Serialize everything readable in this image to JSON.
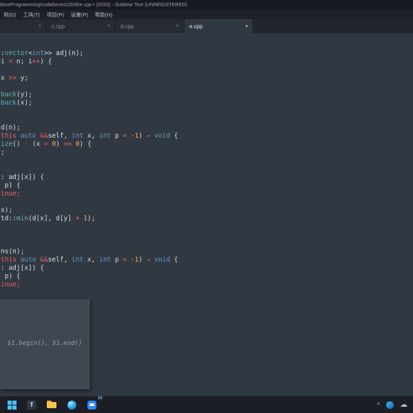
{
  "title_bar": {
    "title": "titiveProgramming\\codeforces\\2028\\e.cpp • (2033) - Sublime Text (UNREGISTERED)"
  },
  "menu_bar": {
    "items": [
      "到(G)",
      "工具(T)",
      "项目(P)",
      "设置(P)",
      "帮助(H)"
    ]
  },
  "tabs": [
    {
      "label": "",
      "close": "×",
      "active": false,
      "partial": true,
      "modified": false
    },
    {
      "label": "c.cpp",
      "close": "×",
      "active": false,
      "partial": false,
      "modified": false
    },
    {
      "label": "d.cpp",
      "close": "×",
      "active": false,
      "partial": false,
      "modified": false
    },
    {
      "label": "e.cpp",
      "close": "•",
      "active": true,
      "partial": false,
      "modified": true
    }
  ],
  "editor": {
    "lines": [
      [
        {
          "c": "fg",
          "t": ":"
        },
        {
          "c": "cyan",
          "t": "vector"
        },
        {
          "c": "fg",
          "t": "<"
        },
        {
          "c": "blue",
          "t": "int"
        },
        {
          "c": "fg",
          "t": ">> adj(n);"
        }
      ],
      [
        {
          "c": "fg",
          "t": "i "
        },
        {
          "c": "red",
          "t": "<"
        },
        {
          "c": "fg",
          "t": " n; i"
        },
        {
          "c": "red",
          "t": "++"
        },
        {
          "c": "fg",
          "t": ") {"
        }
      ],
      [],
      [
        {
          "c": "fg",
          "t": "x "
        },
        {
          "c": "red",
          "t": ">>"
        },
        {
          "c": "fg",
          "t": " y;"
        }
      ],
      [],
      [
        {
          "c": "cyan",
          "t": "back"
        },
        {
          "c": "fg",
          "t": "(y);"
        }
      ],
      [
        {
          "c": "cyan",
          "t": "back"
        },
        {
          "c": "fg",
          "t": "(x);"
        }
      ],
      [],
      [],
      [
        {
          "c": "fg",
          "t": "d(n);"
        }
      ],
      [
        {
          "c": "red",
          "t": "this"
        },
        {
          "c": "fg",
          "t": " "
        },
        {
          "c": "blue",
          "t": "auto"
        },
        {
          "c": "fg",
          "t": " "
        },
        {
          "c": "red",
          "t": "&&"
        },
        {
          "c": "fg",
          "t": "self, "
        },
        {
          "c": "blue",
          "t": "int"
        },
        {
          "c": "fg",
          "t": " x, "
        },
        {
          "c": "blue",
          "t": "int"
        },
        {
          "c": "fg",
          "t": " p "
        },
        {
          "c": "red",
          "t": "="
        },
        {
          "c": "fg",
          "t": " "
        },
        {
          "c": "orange",
          "t": "-1"
        },
        {
          "c": "fg",
          "t": ") "
        },
        {
          "c": "red",
          "t": "→"
        },
        {
          "c": "fg",
          "t": " "
        },
        {
          "c": "blue",
          "t": "void"
        },
        {
          "c": "fg",
          "t": " {"
        }
      ],
      [
        {
          "c": "cyan",
          "t": "ize"
        },
        {
          "c": "fg",
          "t": "() "
        },
        {
          "c": "red",
          "t": "-"
        },
        {
          "c": "fg",
          "t": " (x "
        },
        {
          "c": "red",
          "t": ">"
        },
        {
          "c": "fg",
          "t": " "
        },
        {
          "c": "orange",
          "t": "0"
        },
        {
          "c": "fg",
          "t": ") "
        },
        {
          "c": "red",
          "t": "=="
        },
        {
          "c": "fg",
          "t": " "
        },
        {
          "c": "orange",
          "t": "0"
        },
        {
          "c": "fg",
          "t": ") {"
        }
      ],
      [
        {
          "c": "fg",
          "t": ";"
        }
      ],
      [],
      [],
      [
        {
          "c": "fg",
          "t": ": adj[x]) {"
        }
      ],
      [
        {
          "c": "fg",
          "t": " p) {"
        }
      ],
      [
        {
          "c": "red",
          "t": "inue;"
        }
      ],
      [],
      [
        {
          "c": "fg",
          "t": "x);"
        }
      ],
      [
        {
          "c": "fg",
          "t": "td::"
        },
        {
          "c": "cyan",
          "t": "min"
        },
        {
          "c": "fg",
          "t": "(d[x], d[y] "
        },
        {
          "c": "red",
          "t": "+"
        },
        {
          "c": "fg",
          "t": " "
        },
        {
          "c": "orange",
          "t": "1"
        },
        {
          "c": "fg",
          "t": ");"
        }
      ],
      [],
      [],
      [],
      [
        {
          "c": "fg",
          "t": "ns(n);"
        }
      ],
      [
        {
          "c": "red",
          "t": "this"
        },
        {
          "c": "fg",
          "t": " "
        },
        {
          "c": "blue",
          "t": "auto"
        },
        {
          "c": "fg",
          "t": " "
        },
        {
          "c": "red",
          "t": "&&"
        },
        {
          "c": "fg",
          "t": "self, "
        },
        {
          "c": "blue",
          "t": "int"
        },
        {
          "c": "fg",
          "t": " x, "
        },
        {
          "c": "blue",
          "t": "int"
        },
        {
          "c": "fg",
          "t": " p "
        },
        {
          "c": "red",
          "t": "="
        },
        {
          "c": "fg",
          "t": " "
        },
        {
          "c": "orange",
          "t": "-1"
        },
        {
          "c": "fg",
          "t": ") "
        },
        {
          "c": "red",
          "t": "→"
        },
        {
          "c": "fg",
          "t": " "
        },
        {
          "c": "blue",
          "t": "void"
        },
        {
          "c": "fg",
          "t": " {"
        }
      ],
      [
        {
          "c": "fg",
          "t": ": adj[x]) {"
        }
      ],
      [
        {
          "c": "fg",
          "t": " p) {"
        }
      ],
      [
        {
          "c": "red",
          "t": "inue;"
        }
      ]
    ],
    "popup": {
      "text": "$1.begin(), $1.end()"
    }
  },
  "colors": {
    "editor_bg": "#303841",
    "foreground": "#d8dee9",
    "keyword_red": "#ec5f66",
    "type_blue": "#6699cc",
    "function_cyan": "#5fb4b4",
    "number_orange": "#f9ae58"
  },
  "taskbar": {
    "start_icon": "windows-logo",
    "t_app_label": "T",
    "explorer_icon": "folder",
    "browser_icon": "edge",
    "chat_icon": "chat-bubble",
    "chat_badge": "10",
    "tray": {
      "chevron": "^",
      "cloud": "☁"
    }
  }
}
